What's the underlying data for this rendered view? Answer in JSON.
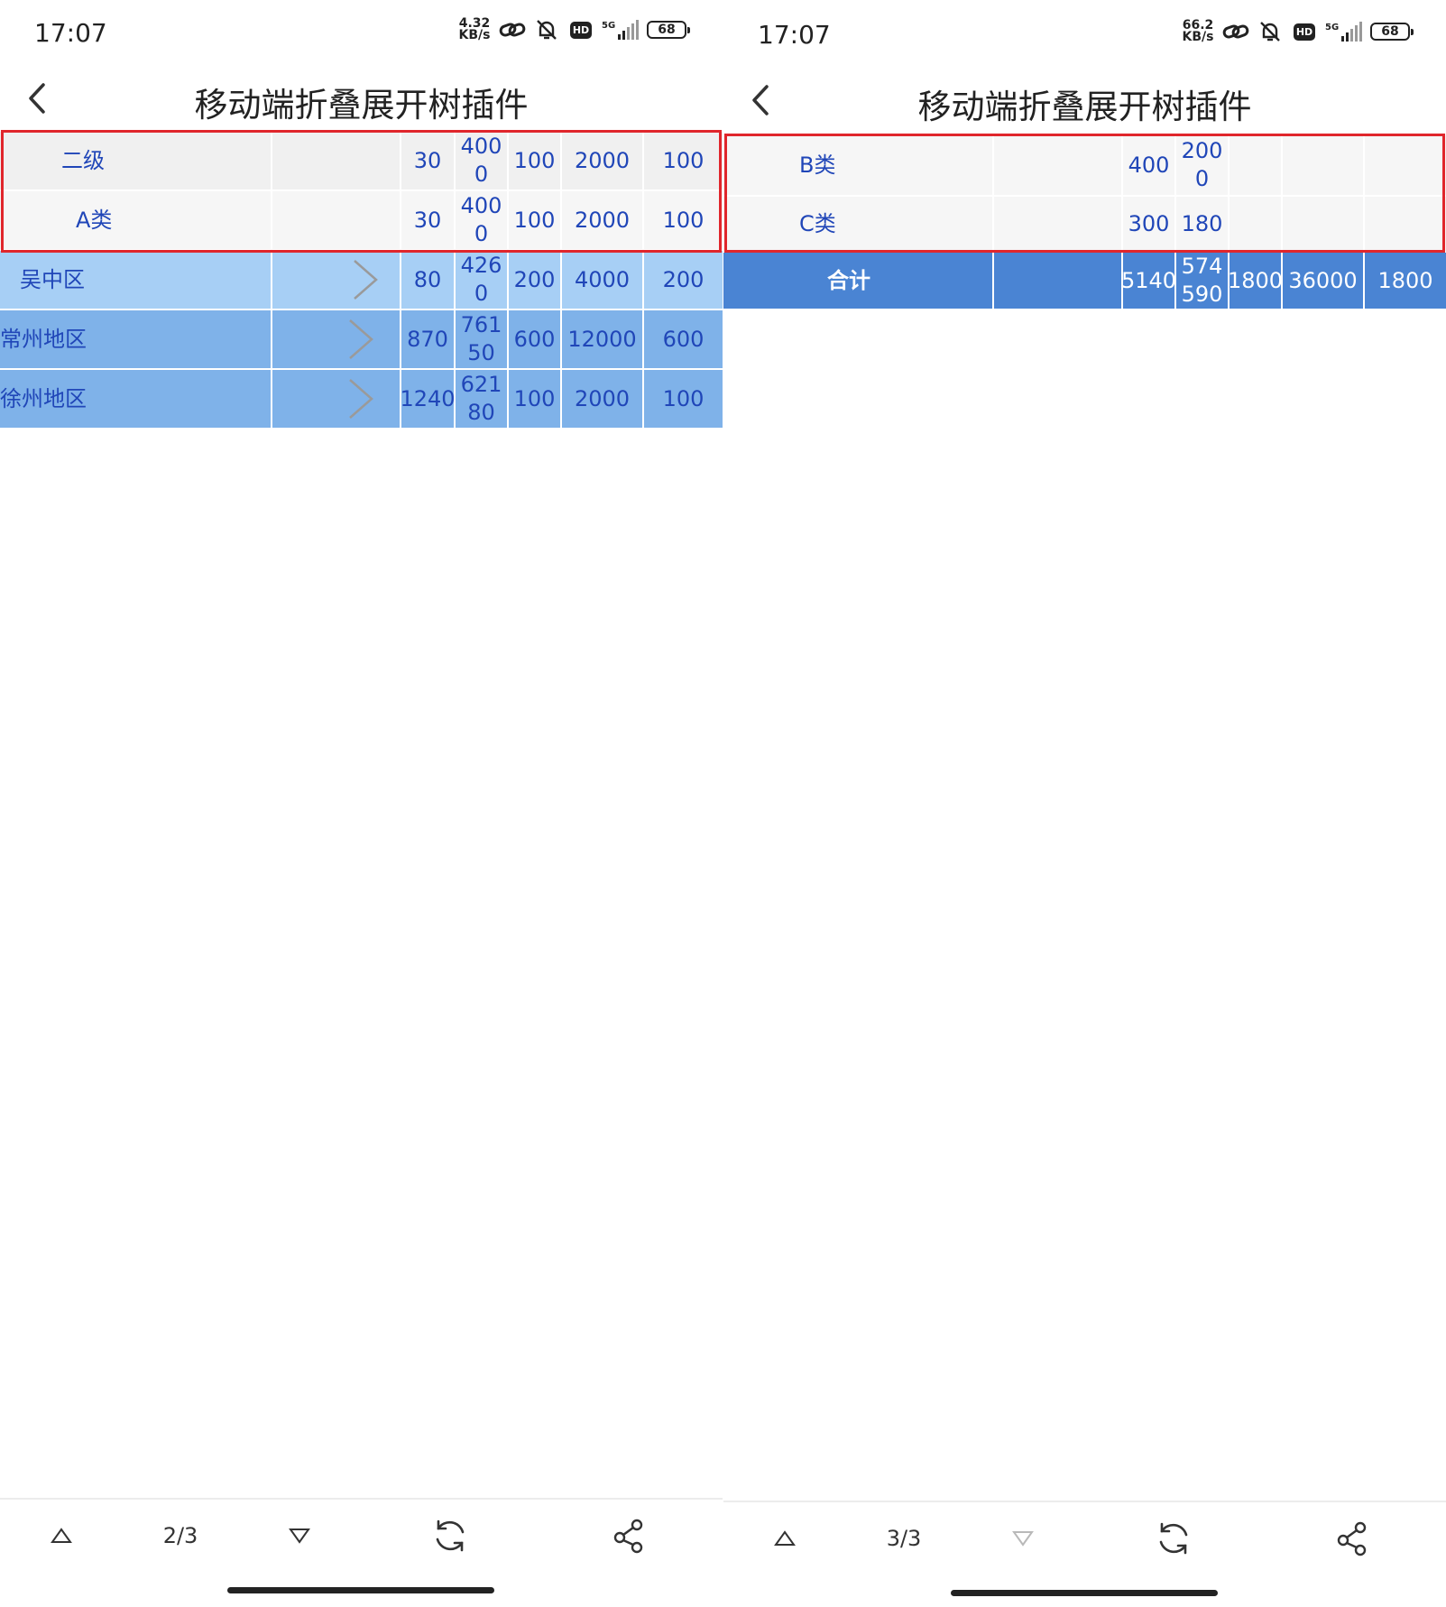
{
  "left": {
    "status": {
      "time": "17:07",
      "speed_value": "4.32",
      "speed_unit": "KB/s",
      "battery": "68",
      "signal": "5G"
    },
    "header": {
      "title": "移动端折叠展开树插件"
    },
    "rows": [
      {
        "name": "二级",
        "cells": [
          "30",
          "4000",
          "100",
          "2000",
          "100"
        ]
      },
      {
        "name": "A类",
        "cells": [
          "30",
          "4000",
          "100",
          "2000",
          "100"
        ]
      },
      {
        "name": "吴中区",
        "cells": [
          "80",
          "4260",
          "200",
          "4000",
          "200"
        ]
      },
      {
        "name": "常州地区",
        "cells": [
          "870",
          "76150",
          "600",
          "12000",
          "600"
        ]
      },
      {
        "name": "徐州地区",
        "cells": [
          "1240",
          "62180",
          "100",
          "2000",
          "100"
        ]
      }
    ],
    "toolbar": {
      "page": "2/3"
    }
  },
  "right": {
    "status": {
      "time": "17:07",
      "speed_value": "66.2",
      "speed_unit": "KB/s",
      "battery": "68",
      "signal": "5G"
    },
    "header": {
      "title": "移动端折叠展开树插件"
    },
    "rows": [
      {
        "name": "B类",
        "cells": [
          "400",
          "2000",
          "",
          "",
          ""
        ]
      },
      {
        "name": "C类",
        "cells": [
          "300",
          "180",
          "",
          "",
          ""
        ]
      }
    ],
    "total": {
      "name": "合计",
      "cells": [
        "5140",
        "574590",
        "1800",
        "36000",
        "1800"
      ]
    },
    "toolbar": {
      "page": "3/3"
    }
  },
  "icons": {
    "back": "chevron-left-icon",
    "expand": "chevron-right-icon",
    "prev_page": "triangle-up-icon",
    "next_page": "triangle-down-icon",
    "refresh": "refresh-icon",
    "share": "share-icon"
  },
  "colors": {
    "text_blue": "#2046b8",
    "row_blue_light": "#a7cff5",
    "row_blue": "#7fb2e9",
    "total_row": "#4a84d3",
    "highlight": "#e0262c"
  }
}
